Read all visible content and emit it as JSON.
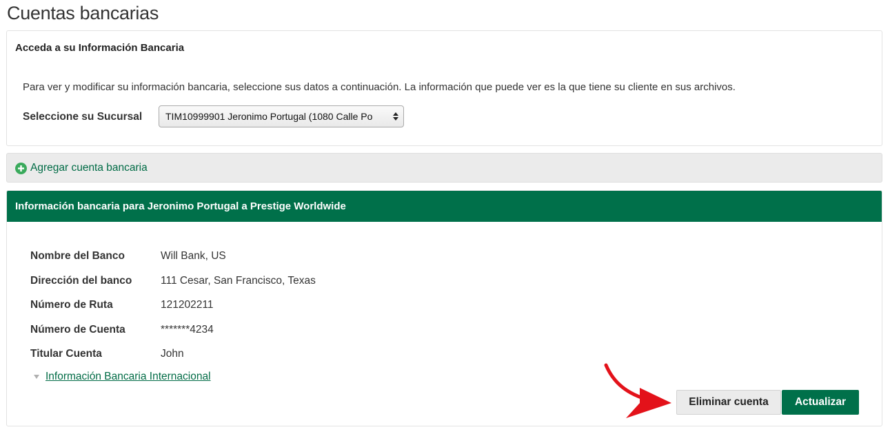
{
  "page": {
    "title": "Cuentas bancarias"
  },
  "access": {
    "title": "Acceda a su Información Bancaria",
    "description": "Para ver y modificar su información bancaria, seleccione sus datos a continuación. La información que puede ver es la que tiene su cliente en sus archivos.",
    "branch_label": "Seleccione su Sucursal",
    "branch_selected": "TIM10999901 Jeronimo Portugal (1080 Calle Po"
  },
  "add_account": {
    "label": "Agregar cuenta bancaria",
    "icon": "plus-circle-icon"
  },
  "bank_info": {
    "header": "Información bancaria para Jeronimo Portugal a Prestige Worldwide",
    "fields": [
      {
        "label": "Nombre del Banco",
        "value": "Will Bank, US"
      },
      {
        "label": "Dirección del banco",
        "value": "111 Cesar, San Francisco, Texas"
      },
      {
        "label": "Número de Ruta",
        "value": "121202211"
      },
      {
        "label": "Número de Cuenta",
        "value": "*******4234"
      },
      {
        "label": "Titular Cuenta",
        "value": "John"
      }
    ],
    "international_link": "Información Bancaria Internacional"
  },
  "actions": {
    "delete_label": "Eliminar cuenta",
    "update_label": "Actualizar"
  },
  "colors": {
    "brand_green": "#00704a",
    "link_green": "#006b45",
    "annotation_red": "#e3121a"
  }
}
